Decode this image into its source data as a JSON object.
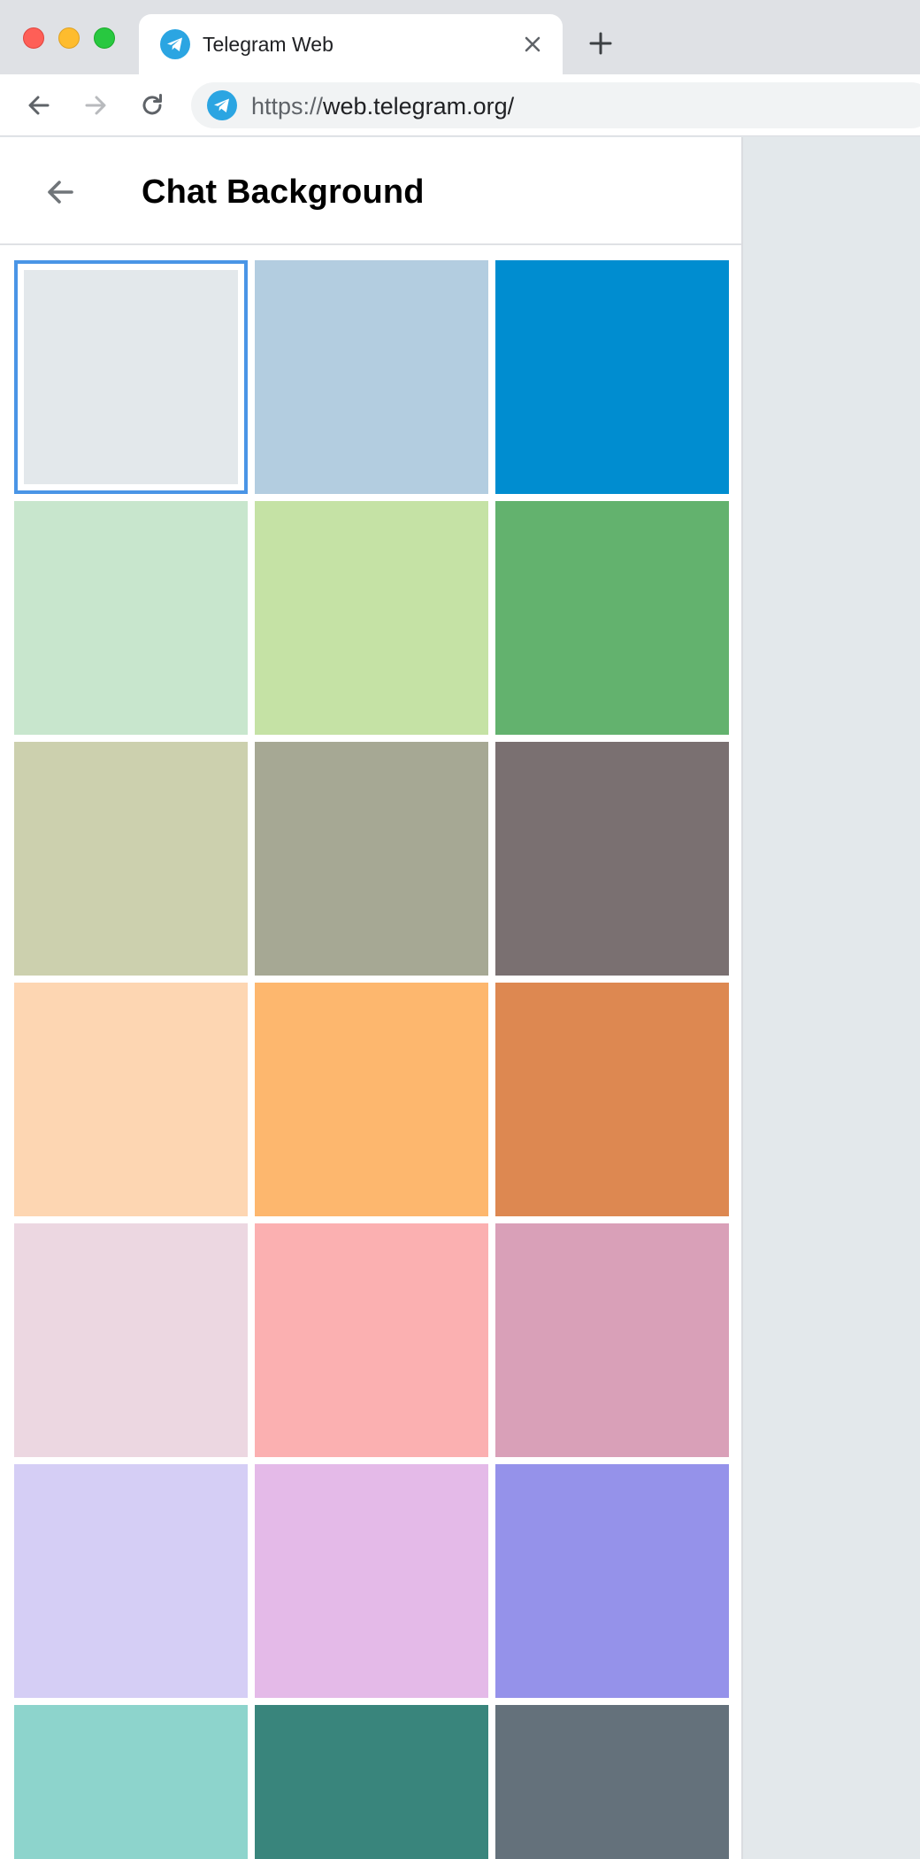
{
  "browser": {
    "tab": {
      "title": "Telegram Web",
      "favicon": "telegram-icon"
    },
    "url_prefix": "https://",
    "url_main": "web.telegram.org/",
    "colors": {
      "tabstrip": "#dfe1e5",
      "telegram_blue": "#2ba5e2"
    }
  },
  "page": {
    "title": "Chat Background",
    "back_icon": "arrow-left-icon"
  },
  "backgrounds": {
    "selected_index": 0,
    "colors": [
      "#e3e8eb",
      "#b3cde0",
      "#008dd0",
      "#c8e6cd",
      "#c5e2a5",
      "#63b26e",
      "#ccd0ae",
      "#a6a894",
      "#7a7071",
      "#fdd6b2",
      "#fdb76e",
      "#dd8851",
      "#ecd7e1",
      "#fbb0b1",
      "#d9a0b8",
      "#d5cef5",
      "#e4bae8",
      "#9592ea",
      "#8dd4cc",
      "#39857c",
      "#64717b"
    ]
  }
}
